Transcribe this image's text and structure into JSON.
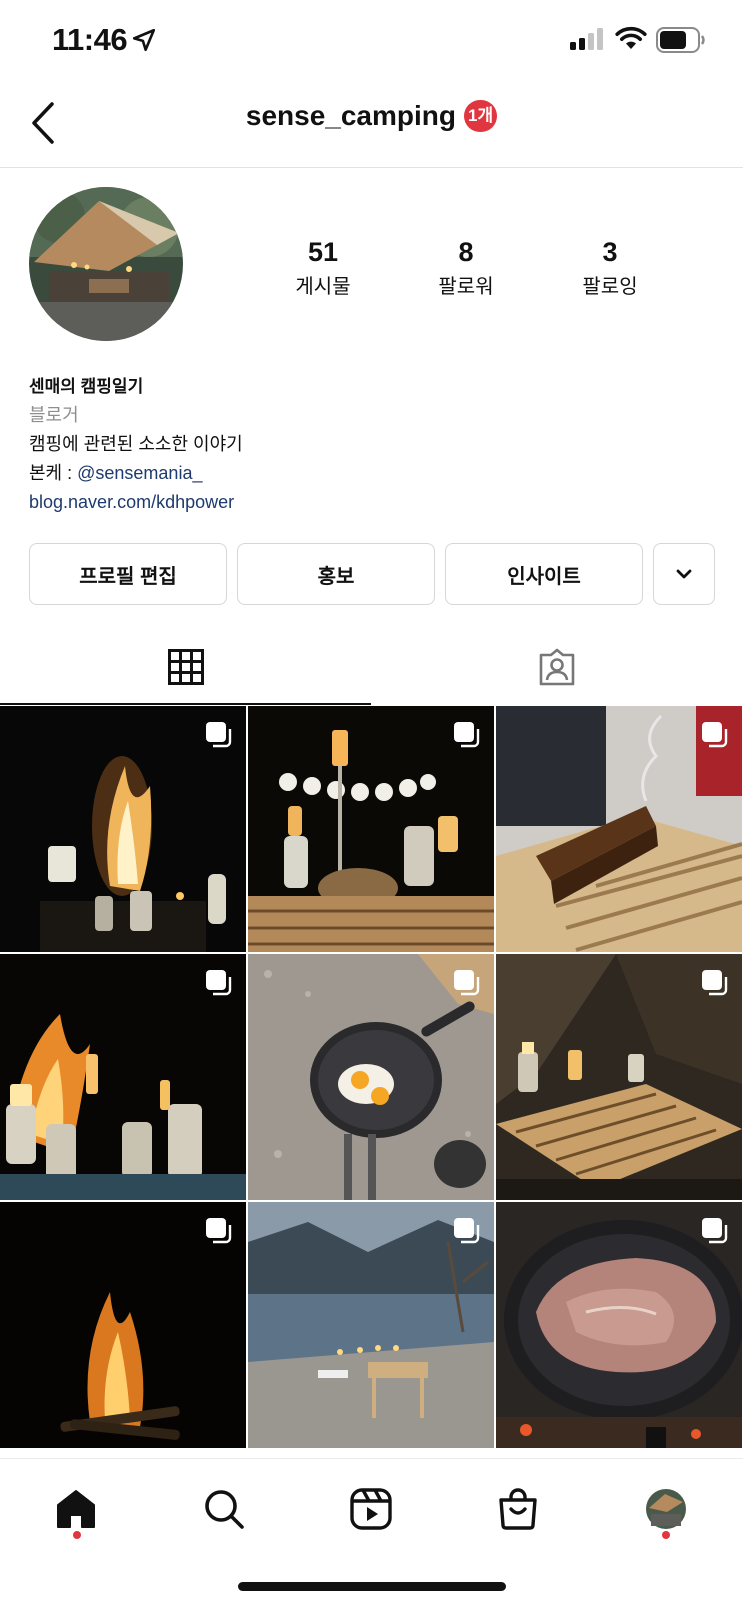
{
  "status_bar": {
    "time": "11:46"
  },
  "header": {
    "username": "sense_camping",
    "badge": "1개"
  },
  "stats": [
    {
      "value": "51",
      "label": "게시물"
    },
    {
      "value": "8",
      "label": "팔로워"
    },
    {
      "value": "3",
      "label": "팔로잉"
    }
  ],
  "bio": {
    "name": "센매의 캠핑일기",
    "category": "블로거",
    "description": "캠핑에 관련된 소소한 이야기",
    "alt_account_prefix": "본케 : ",
    "alt_account": "@sensemania_",
    "link": "blog.naver.com/kdhpower"
  },
  "buttons": {
    "edit_profile": "프로필 편집",
    "promote": "홍보",
    "insights": "인사이트"
  },
  "tabs": [
    {
      "icon": "grid-icon",
      "active": true
    },
    {
      "icon": "tagged-person-icon",
      "active": false
    }
  ],
  "posts": [
    {
      "icon": "carousel-icon"
    },
    {
      "icon": "carousel-icon"
    },
    {
      "icon": "carousel-icon"
    },
    {
      "icon": "carousel-icon"
    },
    {
      "icon": "carousel-icon"
    },
    {
      "icon": "carousel-icon"
    },
    {
      "icon": "carousel-icon"
    },
    {
      "icon": "carousel-icon"
    },
    {
      "icon": "carousel-icon"
    }
  ],
  "bottom_nav": [
    {
      "icon": "home-icon",
      "notification_dot": true
    },
    {
      "icon": "search-icon",
      "notification_dot": false
    },
    {
      "icon": "reels-icon",
      "notification_dot": false
    },
    {
      "icon": "shop-icon",
      "notification_dot": false
    },
    {
      "icon": "profile-avatar-icon",
      "notification_dot": true
    }
  ],
  "colors": {
    "badge": "#e0363f",
    "link": "#1e3a6e",
    "muted": "#8e8e8e"
  }
}
